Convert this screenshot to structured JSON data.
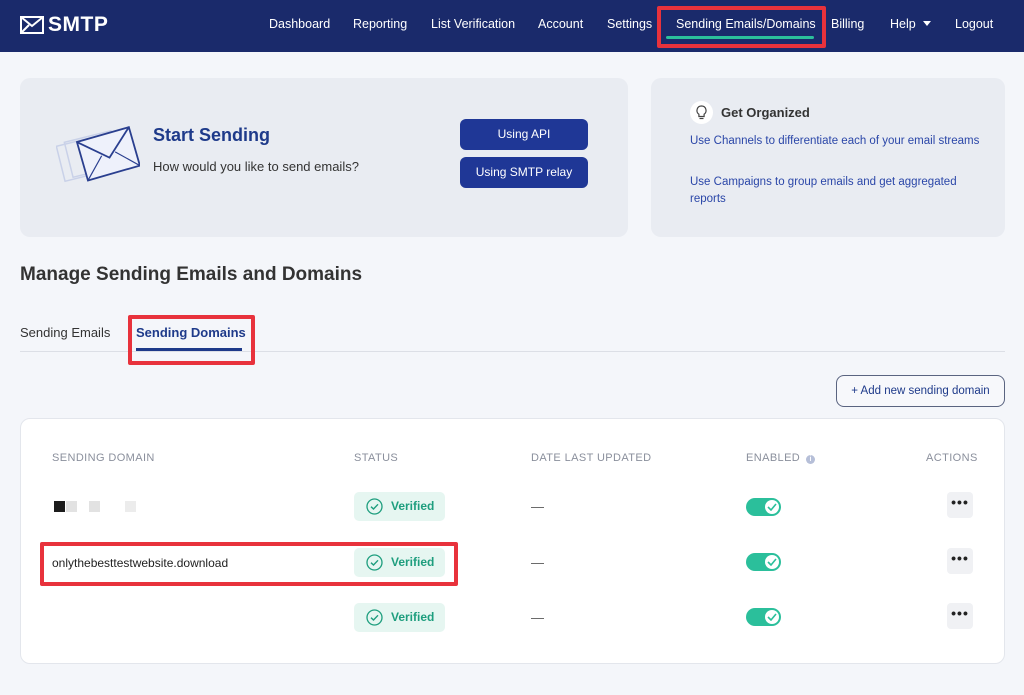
{
  "brand": {
    "name": "SMTP"
  },
  "nav": {
    "items": [
      "Dashboard",
      "Reporting",
      "List Verification",
      "Account",
      "Settings",
      "Sending Emails/Domains",
      "Billing",
      "Help",
      "Logout"
    ]
  },
  "start_card": {
    "title": "Start Sending",
    "subtitle": "How would you like to send emails?",
    "btn_api": "Using API",
    "btn_smtp": "Using SMTP relay",
    "icon": "envelope-stack-icon"
  },
  "organized_card": {
    "title": "Get Organized",
    "link1": "Use Channels to differentiate each of your email streams",
    "link2": "Use Campaigns to group emails and get aggregated reports",
    "icon": "lightbulb-icon"
  },
  "section_title": "Manage Sending Emails and Domains",
  "tabs": [
    "Sending Emails",
    "Sending Domains"
  ],
  "add_button": "+ Add new sending domain",
  "table": {
    "headers": [
      "SENDING DOMAIN",
      "STATUS",
      "DATE LAST UPDATED",
      "ENABLED",
      "ACTIONS"
    ],
    "rows": [
      {
        "domain": "",
        "status": "Verified",
        "date": "—",
        "enabled": true,
        "actions": "•••"
      },
      {
        "domain": "onlythebesttestwebsite.download",
        "status": "Verified",
        "date": "—",
        "enabled": true,
        "actions": "•••"
      },
      {
        "domain": "",
        "status": "Verified",
        "date": "—",
        "enabled": true,
        "actions": "•••"
      }
    ]
  },
  "colors": {
    "nav_bg": "#1a2a6b",
    "primary": "#1f3796",
    "accent": "#2bbf9b",
    "highlight": "#e8323c"
  }
}
